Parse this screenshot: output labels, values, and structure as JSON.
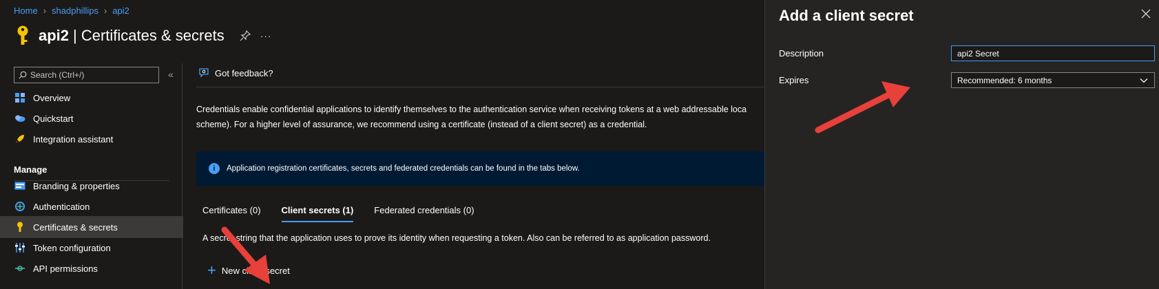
{
  "breadcrumb": {
    "items": [
      "Home",
      "shadphillips",
      "api2"
    ]
  },
  "header": {
    "title": "api2",
    "subtitle": "| Certificates & secrets"
  },
  "sidebar": {
    "search_placeholder": "Search (Ctrl+/)",
    "items_top": [
      {
        "label": "Overview",
        "icon": "overview-icon"
      },
      {
        "label": "Quickstart",
        "icon": "quickstart-icon"
      },
      {
        "label": "Integration assistant",
        "icon": "rocket-icon"
      }
    ],
    "section_manage": "Manage",
    "items_manage": [
      {
        "label": "Branding & properties",
        "icon": "branding-icon"
      },
      {
        "label": "Authentication",
        "icon": "authentication-icon"
      },
      {
        "label": "Certificates & secrets",
        "icon": "key-icon",
        "active": true
      },
      {
        "label": "Token configuration",
        "icon": "token-config-icon"
      },
      {
        "label": "API permissions",
        "icon": "api-permissions-icon"
      }
    ]
  },
  "main": {
    "feedback_label": "Got feedback?",
    "description_line1": "Credentials enable confidential applications to identify themselves to the authentication service when receiving tokens at a web addressable loca",
    "description_line2": "scheme). For a higher level of assurance, we recommend using a certificate (instead of a client secret) as a credential.",
    "info_banner": "Application registration certificates, secrets and federated credentials can be found in the tabs below.",
    "tabs": [
      {
        "label": "Certificates (0)",
        "active": false
      },
      {
        "label": "Client secrets (1)",
        "active": true
      },
      {
        "label": "Federated credentials (0)",
        "active": false
      }
    ],
    "tab_description": "A secret string that the application uses to prove its identity when requesting a token. Also can be referred to as application password.",
    "new_secret_label": "New client secret"
  },
  "panel": {
    "title": "Add a client secret",
    "description_label": "Description",
    "description_value": "api2 Secret",
    "expires_label": "Expires",
    "expires_value": "Recommended: 6 months"
  },
  "colors": {
    "accent": "#479ef5",
    "background": "#1b1a19",
    "panel": "#252423",
    "annotation_arrow": "#e8403a"
  }
}
